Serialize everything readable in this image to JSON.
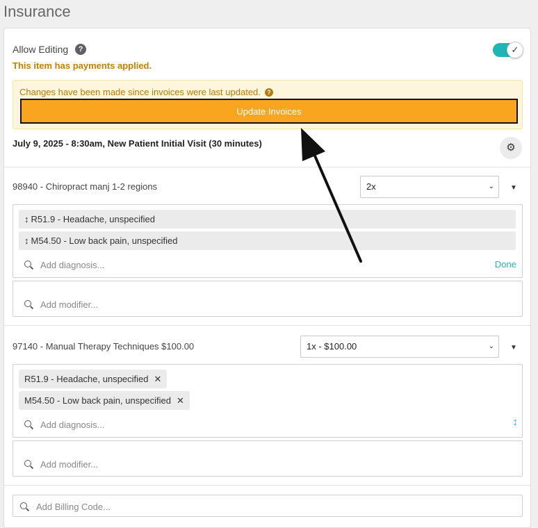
{
  "page": {
    "title": "Insurance"
  },
  "settings": {
    "allow_editing_label": "Allow Editing",
    "help_icon_glyph": "?",
    "payments_note": "This item has payments applied.",
    "toggle_check": "✓"
  },
  "alert": {
    "message": "Changes have been made since invoices were last updated.",
    "help_glyph": "?",
    "button_label": "Update Invoices"
  },
  "visit": {
    "title": "July 9, 2025 - 8:30am, New Patient Initial Visit (30 minutes)",
    "gear_glyph": "⚙"
  },
  "codes": [
    {
      "label": "98940 - Chiropract manj 1-2 regions",
      "quantity": "2x",
      "diagnoses": [
        {
          "drag_glyph": "↕",
          "text": "R51.9 - Headache, unspecified"
        },
        {
          "drag_glyph": "↕",
          "text": "M54.50 - Low back pain, unspecified"
        }
      ],
      "diagnosis_placeholder": "Add diagnosis...",
      "done_label": "Done",
      "modifier_placeholder": "Add modifier..."
    },
    {
      "label": "97140 - Manual Therapy Techniques $100.00",
      "quantity": "1x - $100.00",
      "diagnoses": [
        {
          "text": "R51.9 - Headache, unspecified",
          "remove_glyph": "✕"
        },
        {
          "text": "M54.50 - Low back pain, unspecified",
          "remove_glyph": "✕"
        }
      ],
      "diagnosis_placeholder": "Add diagnosis...",
      "sort_glyph": "↕",
      "modifier_placeholder": "Add modifier..."
    }
  ],
  "billing": {
    "placeholder": "Add Billing Code..."
  },
  "glyphs": {
    "select_chevron": "⌄",
    "caret_down": "▼"
  },
  "colors": {
    "accent_teal": "#1fb5b4",
    "warning_orange": "#f9a520",
    "warning_text": "#c47f00",
    "alert_bg": "#fdf6dc"
  }
}
